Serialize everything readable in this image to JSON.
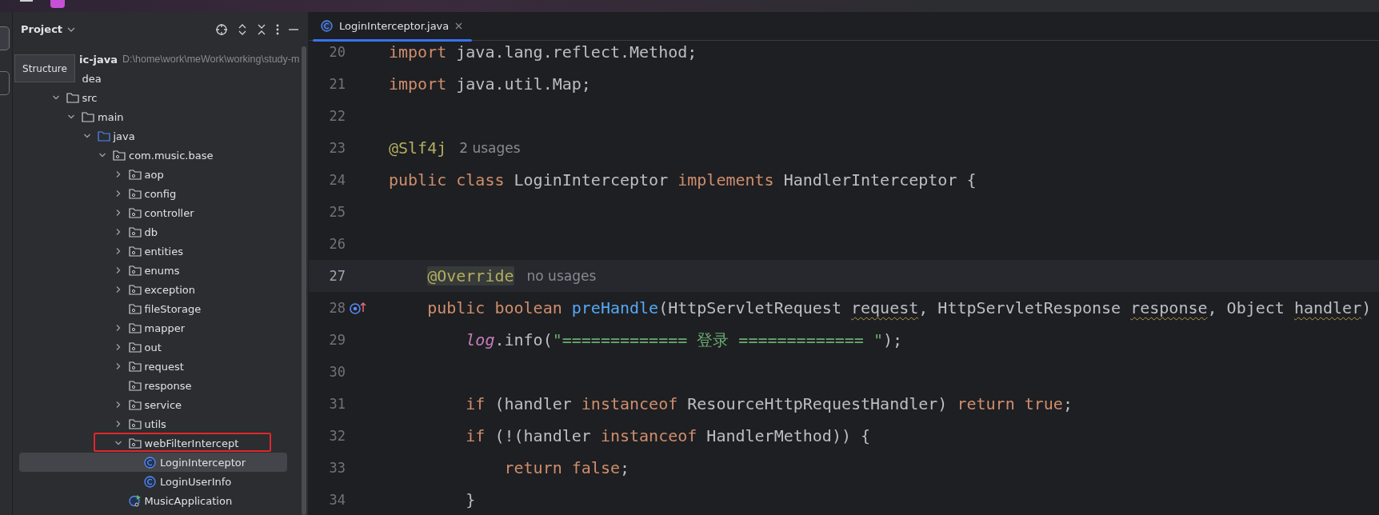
{
  "tool_window": {
    "title": "Project",
    "tooltip": "Structure"
  },
  "tree": [
    {
      "label": "ic-java",
      "path": "D:\\home\\work\\meWork\\working\\study-m",
      "kind": "module",
      "selected": false,
      "children": [
        {
          "label": "dea",
          "kind": "hidden",
          "selected": false
        },
        {
          "label": "src",
          "kind": "folder",
          "expanded": true,
          "selected": false,
          "children": [
            {
              "label": "main",
              "kind": "folder",
              "expanded": true,
              "selected": false,
              "children": [
                {
                  "label": "java",
                  "kind": "source-folder",
                  "expanded": true,
                  "selected": false,
                  "children": [
                    {
                      "label": "com.music.base",
                      "kind": "package",
                      "expanded": true,
                      "selected": false,
                      "children": [
                        {
                          "label": "aop",
                          "kind": "package",
                          "expanded": false,
                          "selected": false
                        },
                        {
                          "label": "config",
                          "kind": "package",
                          "expanded": false,
                          "selected": false
                        },
                        {
                          "label": "controller",
                          "kind": "package",
                          "expanded": false,
                          "selected": false
                        },
                        {
                          "label": "db",
                          "kind": "package",
                          "expanded": false,
                          "selected": false
                        },
                        {
                          "label": "entities",
                          "kind": "package",
                          "expanded": false,
                          "selected": false
                        },
                        {
                          "label": "enums",
                          "kind": "package",
                          "expanded": false,
                          "selected": false
                        },
                        {
                          "label": "exception",
                          "kind": "package",
                          "expanded": false,
                          "selected": false
                        },
                        {
                          "label": "fileStorage",
                          "kind": "package",
                          "selected": false
                        },
                        {
                          "label": "mapper",
                          "kind": "package",
                          "expanded": false,
                          "selected": false
                        },
                        {
                          "label": "out",
                          "kind": "package",
                          "expanded": false,
                          "selected": false
                        },
                        {
                          "label": "request",
                          "kind": "package",
                          "expanded": false,
                          "selected": false
                        },
                        {
                          "label": "response",
                          "kind": "package",
                          "selected": false
                        },
                        {
                          "label": "service",
                          "kind": "package",
                          "expanded": false,
                          "selected": false
                        },
                        {
                          "label": "utils",
                          "kind": "package",
                          "expanded": false,
                          "selected": false
                        },
                        {
                          "label": "webFilterIntercept",
                          "kind": "package",
                          "expanded": true,
                          "selected": false,
                          "marked": true,
                          "children": [
                            {
                              "label": "LoginInterceptor",
                              "kind": "class",
                              "selected": true
                            },
                            {
                              "label": "LoginUserInfo",
                              "kind": "class",
                              "selected": false
                            }
                          ]
                        },
                        {
                          "label": "MusicApplication",
                          "kind": "main-class",
                          "selected": false
                        }
                      ]
                    }
                  ]
                }
              ]
            }
          ]
        }
      ]
    }
  ],
  "editor": {
    "tabs": [
      {
        "label": "LoginInterceptor.java",
        "selected": true
      }
    ],
    "lines": [
      {
        "number": "20",
        "kind": "top",
        "current": false,
        "tokens": [
          {
            "kind": "kw",
            "text": "import"
          },
          {
            "kind": "plain",
            "text": " java.lang.reflect.Method;"
          }
        ]
      },
      {
        "number": "21",
        "kind": "top",
        "current": false,
        "tokens": [
          {
            "kind": "kw",
            "text": "import"
          },
          {
            "kind": "plain",
            "text": " java.util.Map;"
          }
        ]
      },
      {
        "number": "22",
        "kind": "top",
        "current": false
      },
      {
        "number": "23",
        "kind": "top",
        "current": false,
        "tokens": [
          {
            "kind": "annotation",
            "text": "@Slf4j"
          },
          {
            "kind": "hint",
            "text": "2 usages"
          }
        ]
      },
      {
        "number": "24",
        "kind": "top",
        "current": false,
        "tokens": [
          {
            "kind": "kw",
            "text": "public class"
          },
          {
            "kind": "plain",
            "text": " LoginInterceptor "
          },
          {
            "kind": "kw",
            "text": "implements"
          },
          {
            "kind": "plain",
            "text": " HandlerInterceptor {"
          }
        ]
      },
      {
        "number": "25",
        "kind": "top",
        "current": false
      },
      {
        "number": "26",
        "kind": "top",
        "current": false
      },
      {
        "number": "27",
        "kind": "member",
        "current": true,
        "tokens": [
          {
            "kind": "annotation-match",
            "text": "@Override"
          },
          {
            "kind": "hint",
            "text": "no usages"
          }
        ]
      },
      {
        "number": "28",
        "kind": "member",
        "current": false,
        "overrides": true,
        "tokens": [
          {
            "kind": "kw",
            "text": "public boolean "
          },
          {
            "kind": "method",
            "text": "preHandle"
          },
          {
            "kind": "plain",
            "text": "(HttpServletRequest "
          },
          {
            "kind": "param",
            "text": "request"
          },
          {
            "kind": "plain",
            "text": ", HttpServletResponse "
          },
          {
            "kind": "param",
            "text": "response"
          },
          {
            "kind": "plain",
            "text": ", Object "
          },
          {
            "kind": "param",
            "text": "handler"
          },
          {
            "kind": "plain",
            "text": ")"
          }
        ]
      },
      {
        "number": "29",
        "kind": "statement",
        "current": false,
        "tokens": [
          {
            "kind": "field",
            "text": "log"
          },
          {
            "kind": "plain",
            "text": ".info("
          },
          {
            "kind": "string",
            "text": "\"============= 登录 ============= \""
          },
          {
            "kind": "plain",
            "text": ");"
          }
        ]
      },
      {
        "number": "30",
        "kind": "top",
        "current": false
      },
      {
        "number": "31",
        "kind": "statement",
        "current": false,
        "tokens": [
          {
            "kind": "kw",
            "text": "if"
          },
          {
            "kind": "plain",
            "text": " (handler "
          },
          {
            "kind": "kw",
            "text": "instanceof"
          },
          {
            "kind": "plain",
            "text": " ResourceHttpRequestHandler) "
          },
          {
            "kind": "kw",
            "text": "return true"
          },
          {
            "kind": "plain",
            "text": ";"
          }
        ]
      },
      {
        "number": "32",
        "kind": "statement",
        "current": false,
        "tokens": [
          {
            "kind": "kw",
            "text": "if"
          },
          {
            "kind": "plain",
            "text": " (!(handler "
          },
          {
            "kind": "kw",
            "text": "instanceof"
          },
          {
            "kind": "plain",
            "text": " HandlerMethod)) {"
          }
        ]
      },
      {
        "number": "33",
        "kind": "inner",
        "current": false,
        "tokens": [
          {
            "kind": "kw",
            "text": "return false"
          },
          {
            "kind": "plain",
            "text": ";"
          }
        ]
      },
      {
        "number": "34",
        "kind": "statement",
        "current": false,
        "tokens": [
          {
            "kind": "plain",
            "text": "}"
          }
        ]
      }
    ]
  }
}
